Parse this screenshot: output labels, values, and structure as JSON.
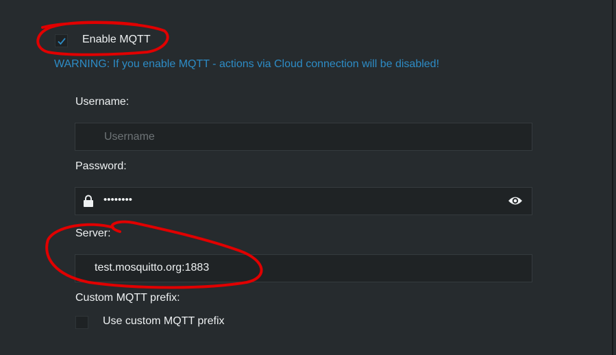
{
  "mqtt": {
    "enable_label": "Enable MQTT",
    "enabled": true,
    "warning": "WARNING: If you enable MQTT - actions via Cloud connection will be disabled!"
  },
  "username": {
    "label": "Username:",
    "placeholder": "Username",
    "value": ""
  },
  "password": {
    "label": "Password:",
    "masked_value": "••••••••"
  },
  "server": {
    "label": "Server:",
    "value": "test.mosquitto.org:1883"
  },
  "prefix": {
    "label": "Custom MQTT prefix:",
    "checkbox_label": "Use custom MQTT prefix",
    "enabled": false
  },
  "colors": {
    "background": "#262b2e",
    "warning": "#2d8cc6",
    "checkmark": "#2d8cc6",
    "annotation": "#e00000"
  },
  "icons": {
    "password_lock": "lock-icon",
    "password_toggle": "eye-icon",
    "check": "checkmark-icon"
  }
}
